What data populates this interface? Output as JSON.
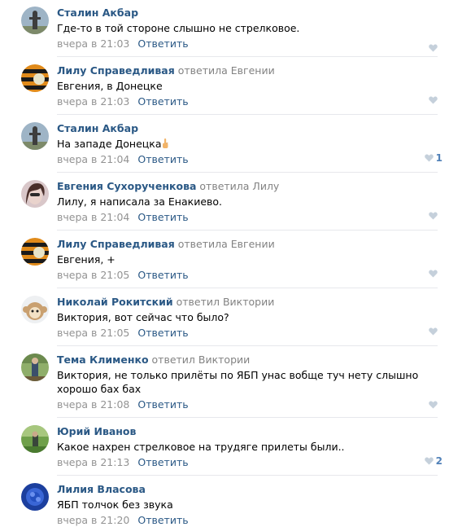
{
  "comments": [
    {
      "author": "Сталин Акбар",
      "replied": "",
      "text": "Где-то в той стороне слышно не стрелковое.",
      "time": "вчера в 21:03",
      "reply": "Ответить",
      "likes": ""
    },
    {
      "author": "Лилу Справедливая",
      "replied": "ответила Евгении",
      "text": "Евгения, в Донецке",
      "time": "вчера в 21:03",
      "reply": "Ответить",
      "likes": ""
    },
    {
      "author": "Сталин Акбар",
      "replied": "",
      "text": "На западе Донецка",
      "time": "вчера в 21:04",
      "reply": "Ответить",
      "likes": "1"
    },
    {
      "author": "Евгения Сухорученкова",
      "replied": "ответила Лилу",
      "text": "Лилу, я написала за Енакиево.",
      "time": "вчера в 21:04",
      "reply": "Ответить",
      "likes": ""
    },
    {
      "author": "Лилу Справедливая",
      "replied": "ответила Евгении",
      "text": "Евгения, +",
      "time": "вчера в 21:05",
      "reply": "Ответить",
      "likes": ""
    },
    {
      "author": "Николай Рокитский",
      "replied": "ответил Виктории",
      "text": "Виктория, вот сейчас что было?",
      "time": "вчера в 21:05",
      "reply": "Ответить",
      "likes": ""
    },
    {
      "author": "Тема Клименко",
      "replied": "ответил Виктории",
      "text": "Виктория, не только прилёты по ЯБП унас вобще туч нету слышно хорошо бах бах",
      "time": "вчера в 21:08",
      "reply": "Ответить",
      "likes": ""
    },
    {
      "author": "Юрий Иванов",
      "replied": "",
      "text": "Какое нахрен стрелковое на трудяге прилеты были..",
      "time": "вчера в 21:13",
      "reply": "Ответить",
      "likes": "2"
    },
    {
      "author": "Лилия Власова",
      "replied": "",
      "text": "ЯБП толчок без звука",
      "time": "вчера в 21:20",
      "reply": "Ответить",
      "likes": ""
    }
  ],
  "colors": {
    "link": "#2a5885",
    "meta": "#939393",
    "like": "#5181b8",
    "divider": "#e7e8ec"
  }
}
